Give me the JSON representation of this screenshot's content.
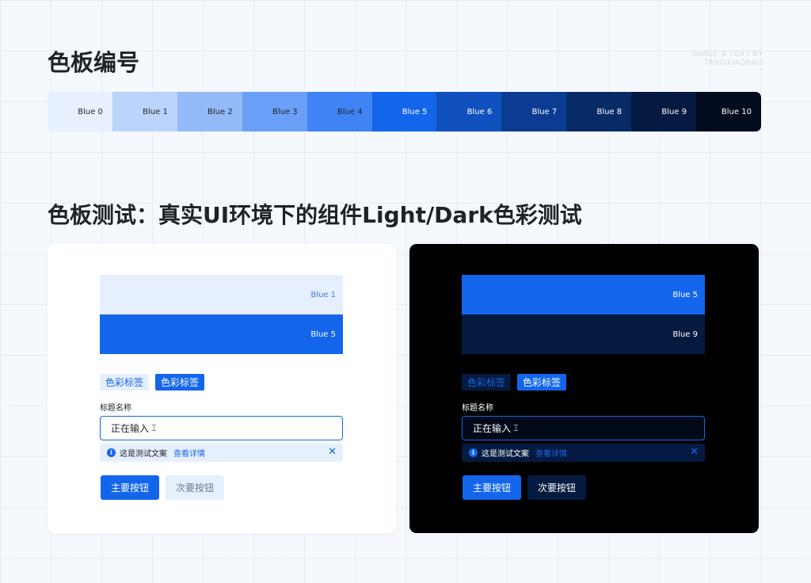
{
  "header": {
    "title": "色板编号",
    "credit_line1": "IMAGE & TEXT BY",
    "credit_line2": "TANGXIAOBAO"
  },
  "palette": [
    {
      "label": "Blue 0",
      "color": "#e8f0fe",
      "text": "#1f2227"
    },
    {
      "label": "Blue 1",
      "color": "#bcd4fb",
      "text": "#1f2227"
    },
    {
      "label": "Blue 2",
      "color": "#94baf9",
      "text": "#1f2227"
    },
    {
      "label": "Blue 3",
      "color": "#6a9ff7",
      "text": "#1f2227"
    },
    {
      "label": "Blue 4",
      "color": "#3f83f5",
      "text": "#1f2227"
    },
    {
      "label": "Blue 5",
      "color": "#1366ec",
      "text": "#ffffff"
    },
    {
      "label": "Blue 6",
      "color": "#0f50be",
      "text": "#ffffff"
    },
    {
      "label": "Blue 7",
      "color": "#0b3c91",
      "text": "#ffffff"
    },
    {
      "label": "Blue 8",
      "color": "#082a66",
      "text": "#ffffff"
    },
    {
      "label": "Blue 9",
      "color": "#051a40",
      "text": "#ffffff"
    },
    {
      "label": "Blue 10",
      "color": "#020c1e",
      "text": "#ffffff"
    }
  ],
  "section_title": "色板测试：真实UI环境下的组件Light/Dark色彩测试",
  "light": {
    "band_top": "Blue 1",
    "band_bottom": "Blue 5",
    "tag_light": "色彩标签",
    "tag_solid": "色彩标签",
    "field_label": "标题名称",
    "input_value": "正在输入",
    "alert_text": "这是测试文案",
    "alert_link": "查看详情",
    "primary_button": "主要按钮",
    "secondary_button": "次要按钮"
  },
  "dark": {
    "band_top": "Blue 5",
    "band_bottom": "Blue 9",
    "tag_light": "色彩标签",
    "tag_solid": "色彩标签",
    "field_label": "标题名称",
    "input_value": "正在输入",
    "alert_text": "这是测试文案",
    "alert_link": "查看详情",
    "primary_button": "主要按钮",
    "secondary_button": "次要按钮"
  },
  "colors": {
    "blue5": "#1366ec",
    "blue1": "#e6effd",
    "blue9": "#051a40",
    "text_dark": "#1f2227"
  },
  "icons": [
    "info-icon",
    "close-icon",
    "text-cursor-icon"
  ]
}
